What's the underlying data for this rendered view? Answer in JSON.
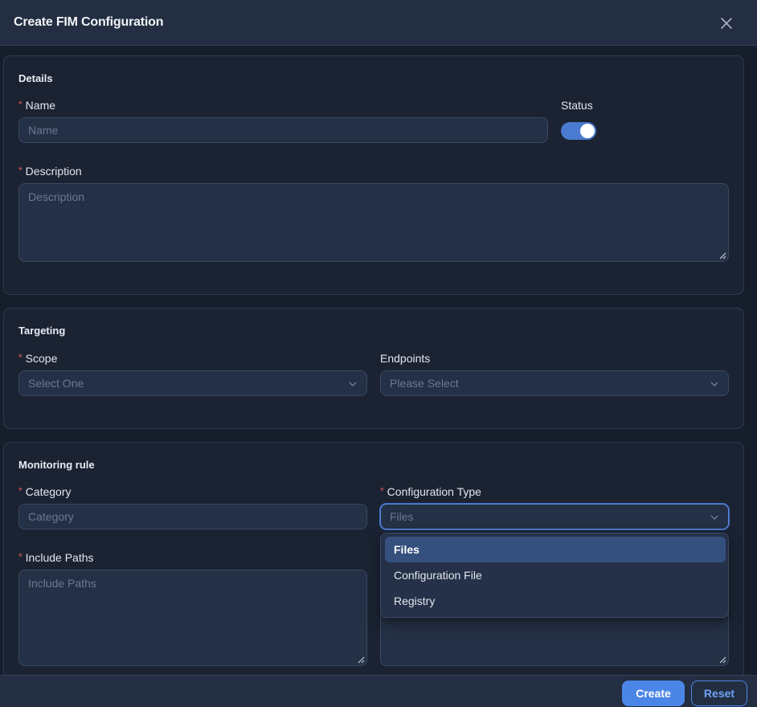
{
  "dialog": {
    "title": "Create FIM Configuration",
    "close_icon": "close-icon"
  },
  "details": {
    "title": "Details",
    "name_label": "Name",
    "name_placeholder": "Name",
    "status_label": "Status",
    "status_on": true,
    "description_label": "Description",
    "description_placeholder": "Description"
  },
  "targeting": {
    "title": "Targeting",
    "scope_label": "Scope",
    "scope_placeholder": "Select One",
    "endpoints_label": "Endpoints",
    "endpoints_placeholder": "Please Select"
  },
  "monitoring": {
    "title": "Monitoring rule",
    "category_label": "Category",
    "category_placeholder": "Category",
    "config_type_label": "Configuration Type",
    "config_type_value": "Files",
    "include_paths_label": "Include Paths",
    "include_paths_placeholder": "Include Paths",
    "config_type_options": [
      "Files",
      "Configuration File",
      "Registry"
    ],
    "selected_option": "Files"
  },
  "footer": {
    "create_label": "Create",
    "reset_label": "Reset"
  },
  "colors": {
    "accent": "#4b86e6",
    "required": "#e05656",
    "background": "#161d2b"
  }
}
